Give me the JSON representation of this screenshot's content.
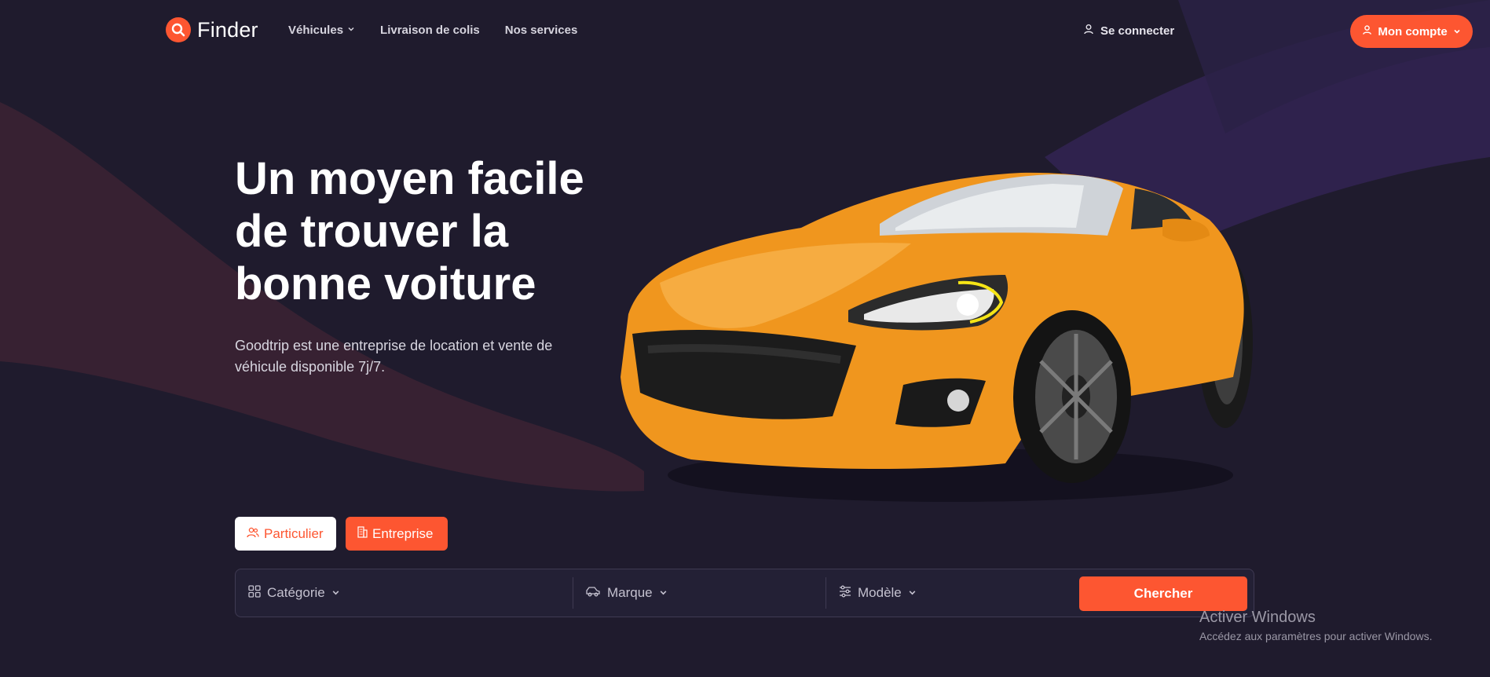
{
  "header": {
    "brand": "Finder",
    "nav": [
      {
        "label": "Véhicules",
        "has_dropdown": true
      },
      {
        "label": "Livraison de colis",
        "has_dropdown": false
      },
      {
        "label": "Nos services",
        "has_dropdown": false
      }
    ],
    "login_label": "Se connecter",
    "account_label": "Mon compte"
  },
  "hero": {
    "title": "Un moyen facile de trouver la bonne voiture",
    "subtitle": "Goodtrip est une entreprise de location et vente de véhicule disponible 7j/7."
  },
  "toggles": {
    "particulier": "Particulier",
    "entreprise": "Entreprise",
    "active": "entreprise"
  },
  "search": {
    "category": "Catégorie",
    "brand": "Marque",
    "model": "Modèle",
    "button": "Chercher"
  },
  "watermark": {
    "line1": "Activer Windows",
    "line2": "Accédez aux paramètres pour activer Windows."
  },
  "colors": {
    "accent": "#fd5631",
    "background": "#1f1b2d",
    "car": "#f0961e"
  },
  "icons": [
    "search-icon",
    "chevron-down-icon",
    "user-icon",
    "users-icon",
    "building-icon",
    "grid-icon",
    "car-icon",
    "sliders-icon"
  ]
}
